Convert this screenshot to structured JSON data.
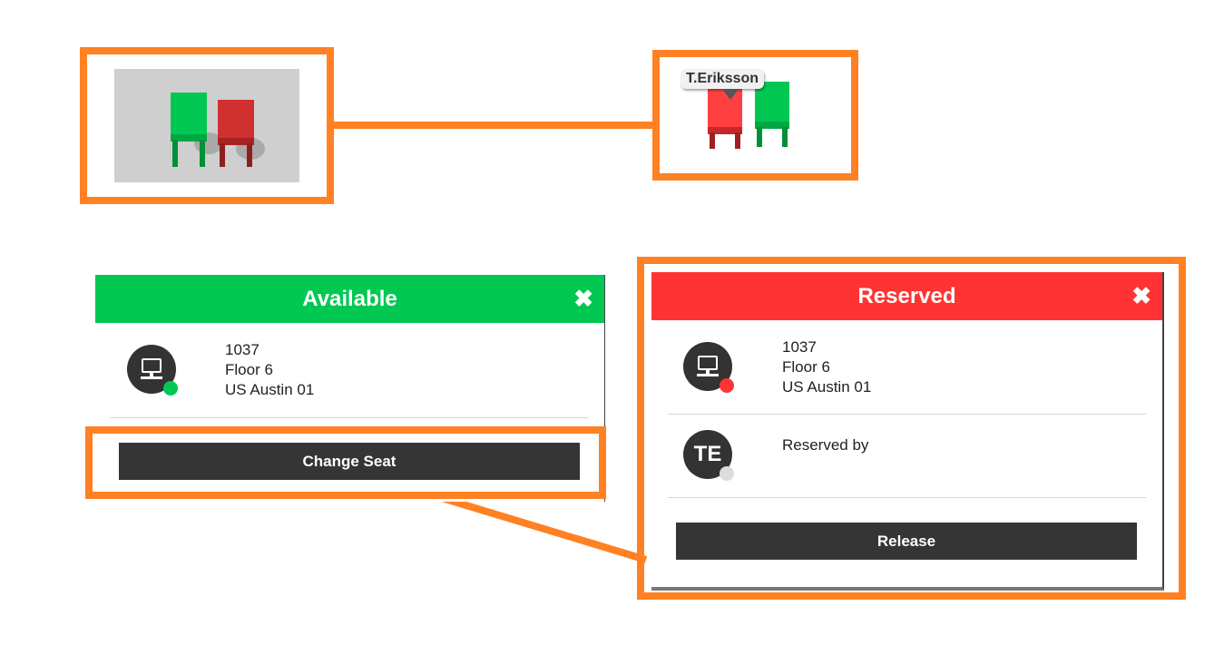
{
  "thumbnail_tag": {
    "name": "T.Eriksson"
  },
  "colors": {
    "accent_orange": "#FF8124",
    "available_green": "#00C853",
    "reserved_red": "#FF3333",
    "button_dark": "#353535"
  },
  "available_panel": {
    "title": "Available",
    "close_icon": "close-icon",
    "desk": {
      "id": "1037",
      "floor": "Floor 6",
      "location": "US Austin 01",
      "icon": "monitor-icon",
      "status": "available"
    },
    "button_label": "Change Seat"
  },
  "reserved_panel": {
    "title": "Reserved",
    "close_icon": "close-icon",
    "desk": {
      "id": "1037",
      "floor": "Floor 6",
      "location": "US Austin 01",
      "icon": "monitor-icon",
      "status": "reserved"
    },
    "reserved_by": {
      "label": "Reserved by",
      "initials": "TE"
    },
    "button_label": "Release"
  }
}
